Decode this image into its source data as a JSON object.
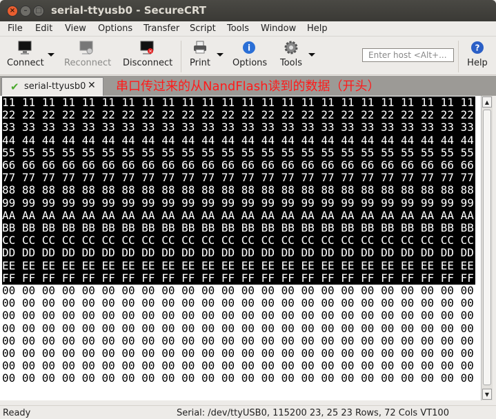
{
  "window": {
    "title": "serial-ttyusb0 - SecureCRT"
  },
  "menu": [
    "File",
    "Edit",
    "View",
    "Options",
    "Transfer",
    "Script",
    "Tools",
    "Window",
    "Help"
  ],
  "toolbar": {
    "connect": "Connect",
    "reconnect": "Reconnect",
    "disconnect": "Disconnect",
    "print": "Print",
    "options": "Options",
    "tools": "Tools",
    "help": "Help",
    "host_placeholder": "Enter host <Alt+..."
  },
  "tab": {
    "label": "serial-ttyusb0"
  },
  "annotation": "串口传过来的从NandFlash读到的数据（开头）",
  "terminal": {
    "rows": [
      {
        "text": "11 11 11 11 11 11 11 11 11 11 11 11 11 11 11 11 11 11 11 11 11 11 11 11",
        "selected": true
      },
      {
        "text": "22 22 22 22 22 22 22 22 22 22 22 22 22 22 22 22 22 22 22 22 22 22 22 22",
        "selected": true
      },
      {
        "text": "33 33 33 33 33 33 33 33 33 33 33 33 33 33 33 33 33 33 33 33 33 33 33 33",
        "selected": true
      },
      {
        "text": "44 44 44 44 44 44 44 44 44 44 44 44 44 44 44 44 44 44 44 44 44 44 44 44",
        "selected": true
      },
      {
        "text": "55 55 55 55 55 55 55 55 55 55 55 55 55 55 55 55 55 55 55 55 55 55 55 55",
        "selected": true
      },
      {
        "text": "66 66 66 66 66 66 66 66 66 66 66 66 66 66 66 66 66 66 66 66 66 66 66 66",
        "selected": true
      },
      {
        "text": "77 77 77 77 77 77 77 77 77 77 77 77 77 77 77 77 77 77 77 77 77 77 77 77",
        "selected": true
      },
      {
        "text": "88 88 88 88 88 88 88 88 88 88 88 88 88 88 88 88 88 88 88 88 88 88 88 88",
        "selected": true
      },
      {
        "text": "99 99 99 99 99 99 99 99 99 99 99 99 99 99 99 99 99 99 99 99 99 99 99 99",
        "selected": true
      },
      {
        "text": "AA AA AA AA AA AA AA AA AA AA AA AA AA AA AA AA AA AA AA AA AA AA AA AA",
        "selected": true
      },
      {
        "text": "BB BB BB BB BB BB BB BB BB BB BB BB BB BB BB BB BB BB BB BB BB BB BB BB",
        "selected": true
      },
      {
        "text": "CC CC CC CC CC CC CC CC CC CC CC CC CC CC CC CC CC CC CC CC CC CC CC CC",
        "selected": true
      },
      {
        "text": "DD DD DD DD DD DD DD DD DD DD DD DD DD DD DD DD DD DD DD DD DD DD DD DD",
        "selected": true
      },
      {
        "text": "EE EE EE EE EE EE EE EE EE EE EE EE EE EE EE EE EE EE EE EE EE EE EE EE",
        "selected": true
      },
      {
        "text": "FF FF FF FF FF FF FF FF FF FF FF FF FF FF FF FF FF FF FF FF FF FF FF FF",
        "selected": true
      },
      {
        "text": "00 00 00 00 00 00 00 00 00 00 00 00 00 00 00 00 00 00 00 00 00 00 00 00",
        "selected": false
      },
      {
        "text": "00 00 00 00 00 00 00 00 00 00 00 00 00 00 00 00 00 00 00 00 00 00 00 00",
        "selected": false
      },
      {
        "text": "00 00 00 00 00 00 00 00 00 00 00 00 00 00 00 00 00 00 00 00 00 00 00 00",
        "selected": false
      },
      {
        "text": "00 00 00 00 00 00 00 00 00 00 00 00 00 00 00 00 00 00 00 00 00 00 00 00",
        "selected": false
      },
      {
        "text": "00 00 00 00 00 00 00 00 00 00 00 00 00 00 00 00 00 00 00 00 00 00 00 00",
        "selected": false
      },
      {
        "text": "00 00 00 00 00 00 00 00 00 00 00 00 00 00 00 00 00 00 00 00 00 00 00 00",
        "selected": false
      },
      {
        "text": "00 00 00 00 00 00 00 00 00 00 00 00 00 00 00 00 00 00 00 00 00 00 00 00",
        "selected": false
      },
      {
        "text": "00 00 00 00 00 00 00 00 00 00 00 00 00 00 00 00 00 00 00 00 00 00 00 00",
        "selected": false
      }
    ]
  },
  "status": {
    "left": "Ready",
    "right": "Serial: /dev/ttyUSB0, 115200  23, 25  23 Rows, 72 Cols  VT100"
  }
}
